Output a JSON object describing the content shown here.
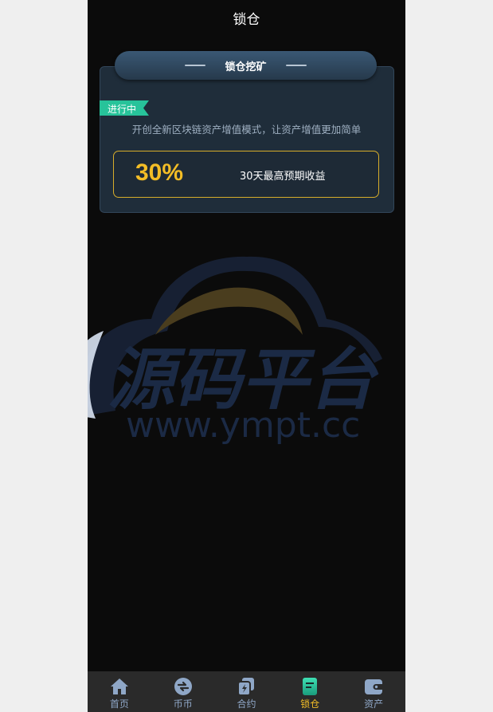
{
  "header": {
    "title": "锁仓"
  },
  "card": {
    "title": "锁仓挖矿",
    "status": "进行中",
    "description": "开创全新区块链资产增值模式，让资产增值更加简单",
    "rate": "30%",
    "rate_label": "30天最高预期收益"
  },
  "watermark": {
    "text_cn": "源码平台",
    "text_url": "www.ympt.cc"
  },
  "tabbar": {
    "items": [
      {
        "label": "首页",
        "icon": "home-icon",
        "active": false
      },
      {
        "label": "币币",
        "icon": "exchange-icon",
        "active": false
      },
      {
        "label": "合约",
        "icon": "contract-icon",
        "active": false
      },
      {
        "label": "锁仓",
        "icon": "lock-document-icon",
        "active": true
      },
      {
        "label": "资产",
        "icon": "wallet-icon",
        "active": false
      }
    ]
  },
  "colors": {
    "accent": "#f3bd26",
    "badge": "#27c39a",
    "tab_inactive": "#8fa7c7",
    "card_bg": "#1f2d3a"
  }
}
